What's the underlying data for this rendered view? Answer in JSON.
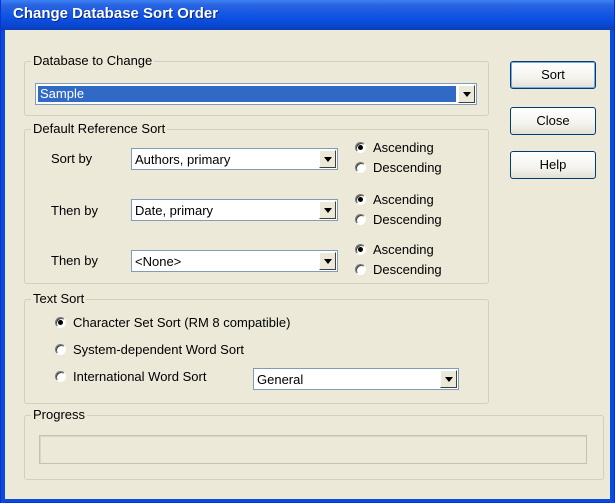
{
  "window": {
    "title": "Change Database Sort Order"
  },
  "database_group": {
    "label": "Database to Change",
    "selected": "Sample"
  },
  "buttons": {
    "sort": "Sort",
    "close": "Close",
    "help": "Help"
  },
  "reference_sort": {
    "label": "Default Reference Sort",
    "rows": [
      {
        "label": "Sort by",
        "value": "Authors, primary",
        "order": "ascending"
      },
      {
        "label": "Then by",
        "value": "Date, primary",
        "order": "ascending"
      },
      {
        "label": "Then by",
        "value": "<None>",
        "order": "ascending"
      }
    ],
    "ascending_label": "Ascending",
    "descending_label": "Descending"
  },
  "text_sort": {
    "label": "Text Sort",
    "options": [
      {
        "label": "Character Set Sort  (RM 8 compatible)",
        "checked": true
      },
      {
        "label": "System-dependent Word Sort",
        "checked": false
      },
      {
        "label": "International Word Sort",
        "checked": false
      }
    ],
    "international_value": "General"
  },
  "progress": {
    "label": "Progress",
    "value": 0
  }
}
